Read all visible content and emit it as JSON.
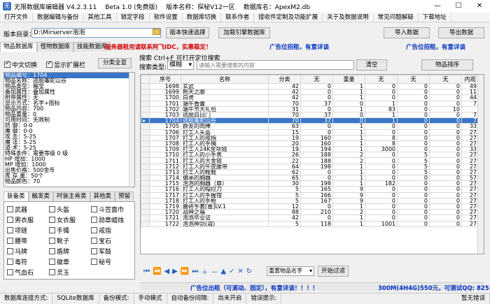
{
  "titlebar": {
    "app": "无限数据库编辑器 V4.2.3.11",
    "beta": "Beta 1.0 (免费版)",
    "version_label": "版本名称：探秘V12一区",
    "db_label": "数据库名：ApexM2.db"
  },
  "menu": [
    "打开文件",
    "数据编辑与备份",
    "其他工具",
    "锁定字段",
    "软件设置",
    "数据库切换",
    "联系作者",
    "接收件定制及功能扩展",
    "关于及数据说明",
    "常见问题解疑",
    "下载地址"
  ],
  "path": {
    "label": "版本目录：",
    "value": "D:\\Mirserver泡泡"
  },
  "buttons": {
    "quick_select": "版本快速选择",
    "load_db": "加载引擎数据库",
    "import": "导入数据",
    "export": "导出数据",
    "filter_all": "分类全显",
    "sort": "物品排序",
    "clear": "清空",
    "start_filter": "开始过滤"
  },
  "tabs": [
    "物品数据库",
    "怪物数据库",
    "技能数据库"
  ],
  "ads": {
    "server_ad": "服务器租用请联系阿飞IDC，实惠稳定！",
    "ad1": "广告位招租，有意详谈",
    "ad2": "广告位招租，有意详谈",
    "bottom_left": "广告位出租（可滚动、固定），有意详谈！！！！",
    "bottom_right": "300M(4H4G)550元，可测试QQ: 8253723"
  },
  "options": {
    "chinese_toggle": "中文切换",
    "show_extension": "显示扩展栏"
  },
  "search": {
    "title": "搜索  Ctrl+F 可打开定位搜索",
    "type_label": "搜索类型:",
    "type_value": "模糊",
    "placeholder": "请输入需要搜索的内容"
  },
  "info_lines": [
    "物品编号：1704",
    "物品名称：逃脱毒蛇山谷",
    "物品类型：箱宝",
    "备加属性：叠加属性",
    "附带属性：无",
    "显示方式：名字+图标",
    "物品内容：700",
    "物品重量：0",
    "可用时间：无限制",
    "防   御：0-0",
    "魔   御：0-0",
    "攻   击：5-25",
    "魔   法：5-25",
    "道   术：5-25",
    "特殊条件：需要等级 0 级",
    "HP 增加：1000",
    "MP 增加：1000",
    "出售价格：500金币",
    "库 存 量：50个",
    "物品颜色：70"
  ],
  "category_tabs": [
    "装备类",
    "触发类",
    "时装主肯类",
    "其他类",
    "预留"
  ],
  "categories": [
    [
      "武器",
      "头盔",
      "斗笠面巾"
    ],
    [
      "男衣服",
      "女衣服",
      "勋章蜡烛"
    ],
    [
      "项链",
      "手镯",
      "戒指"
    ],
    [
      "腰带",
      "靴子",
      "宝石"
    ],
    [
      "马牌",
      "盾牌",
      "军鼓"
    ],
    [
      "毒符",
      "徽章",
      "秘号"
    ],
    [
      "气血石",
      "灵玉",
      ""
    ]
  ],
  "grid": {
    "columns": [
      "序号",
      "名称",
      "分类",
      "无",
      "重量",
      "无",
      "无",
      "无",
      "内观"
    ],
    "rows": [
      [
        "1698",
        "玄武",
        "42",
        "0",
        "1",
        "0",
        "0",
        "0",
        "49"
      ],
      [
        "1699",
        "荆天之脚",
        "42",
        "0",
        "1",
        "0",
        "0",
        "0",
        "11"
      ],
      [
        "1700",
        "白虎",
        "42",
        "0",
        "1",
        "0",
        "0",
        "0",
        "44"
      ],
      [
        "1701",
        "端午香囊",
        "70",
        "37",
        "0",
        "1",
        "0",
        "0",
        "7"
      ],
      [
        "1702",
        "端午节大礼包",
        "31",
        "0",
        "1",
        "83",
        "0",
        "10"
      ],
      [
        "1703",
        "逃脱白日门",
        "70",
        "37",
        "0",
        "1",
        "0",
        "0",
        "7"
      ],
      [
        "1704",
        "逃脱毒蛇山谷",
        "70",
        "37",
        "0",
        "1",
        "0",
        "0",
        "7"
      ],
      [
        "1705",
        "群友的肉棒",
        "63",
        "0",
        "1",
        "0",
        "0",
        "0",
        "33"
      ],
      [
        "1706",
        "打工人头盔",
        "15",
        "0",
        "1",
        "0",
        "0",
        "0",
        "27"
      ],
      [
        "1707",
        "打工人的戒指",
        "19",
        "160",
        "1",
        "8",
        "0",
        "0",
        "27"
      ],
      [
        "1708",
        "打工人的手镯",
        "20",
        "160",
        "1",
        "8",
        "0",
        "0",
        "27"
      ],
      [
        "1709",
        "打工人24K金项链",
        "19",
        "194",
        "1",
        "3000",
        "0",
        "0",
        "33"
      ],
      [
        "1710",
        "打工人的小手表",
        "26",
        "188",
        "2",
        "0",
        "5",
        "0",
        "27"
      ],
      [
        "1711",
        "打工人的大金链",
        "22",
        "188",
        "2",
        "0",
        "5",
        "0",
        "27"
      ],
      [
        "1712",
        "打工人的牛皮腰带",
        "64",
        "198",
        "1",
        "0",
        "5",
        "0",
        "27"
      ],
      [
        "1713",
        "打工人的靴鞋",
        "62",
        "0",
        "1",
        "0",
        "5",
        "0",
        "27"
      ],
      [
        "1714",
        "偏承的胸器",
        "65",
        "0",
        "1",
        "0",
        "0",
        "0",
        "57"
      ],
      [
        "1715",
        "泡泡的胸器（章）",
        "30",
        "198",
        "1",
        "182",
        "0",
        "0",
        "27"
      ],
      [
        "1716",
        "打工人的帽拉刀",
        "5",
        "165",
        "9",
        "0",
        "0",
        "0",
        "27"
      ],
      [
        "1717",
        "打工人的手握钳",
        "5",
        "166",
        "9",
        "0",
        "0",
        "0",
        "27"
      ],
      [
        "1718",
        "打工人的手枪",
        "5",
        "167",
        "9",
        "0",
        "0",
        "0",
        "27"
      ],
      [
        "1719",
        "搬砖手套[番]LV.1",
        "12",
        "0",
        "1",
        "0",
        "0",
        "0",
        "27"
      ],
      [
        "1720",
        "战神之福",
        "88",
        "210",
        "2",
        "0",
        "0",
        "0",
        "27"
      ],
      [
        "1721",
        "泡泡毕业证",
        "42",
        "0",
        "1",
        "0",
        "0",
        "0",
        "27"
      ],
      [
        "1722",
        "泡泡神剑(减)",
        "5",
        "118",
        "1",
        "1001",
        "0",
        "0",
        "27"
      ]
    ]
  },
  "nav": {
    "dropdown": "重置物品名字"
  },
  "status": [
    "数据库连接方式:",
    "SQLite数据库",
    "备份模式:",
    "手动模式",
    "自动备份间隔:",
    "尚未开启",
    "错误提示:",
    "暂无错误"
  ],
  "colors": {
    "selection": "#3a76c8",
    "ad_red": "#d00000",
    "ad_blue": "#0030c0"
  }
}
